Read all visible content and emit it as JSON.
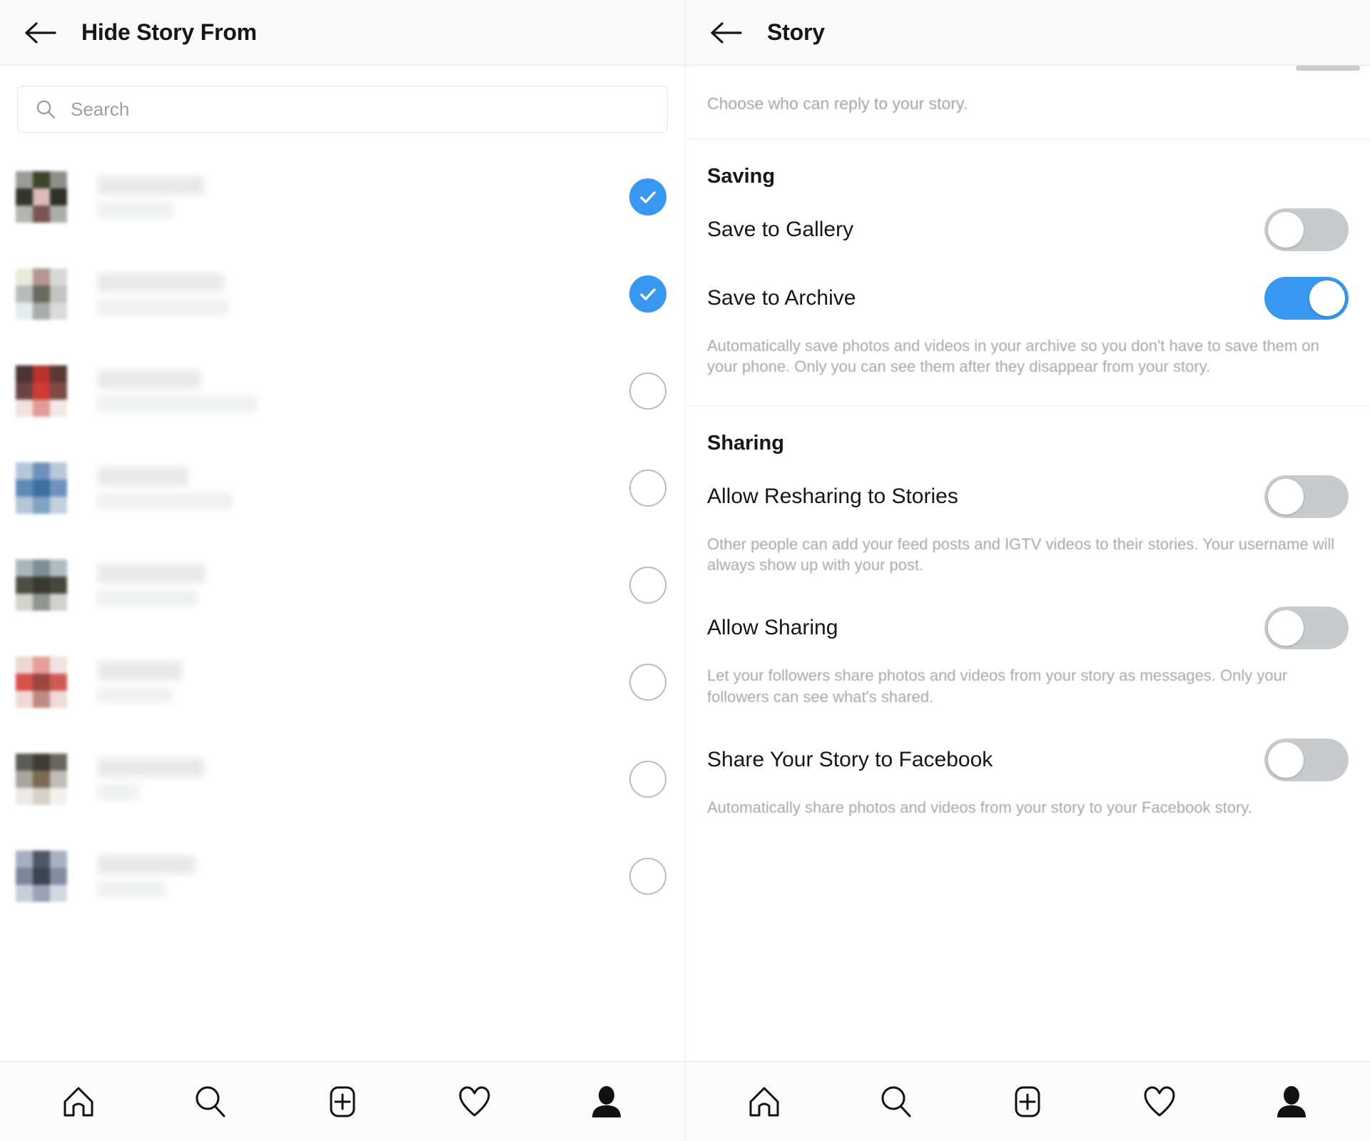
{
  "left_pane": {
    "header": {
      "back_icon": "back-arrow-icon",
      "title": "Hide Story From"
    },
    "search": {
      "icon": "search-icon",
      "placeholder": "Search",
      "value": ""
    },
    "users": [
      {
        "name_width": 150,
        "handle_width": 108,
        "checked": true,
        "avatar": [
          "#9b9b97",
          "#3f4527",
          "#8e8f8c",
          "#33362c",
          "#dcbbb9",
          "#2e3128",
          "#b5b4b0",
          "#7a5452",
          "#aeada9"
        ]
      },
      {
        "name_width": 178,
        "handle_width": 185,
        "checked": true,
        "avatar": [
          "#e9ebd9",
          "#b49792",
          "#d8d9d4",
          "#b8bcbd",
          "#6c6a5e",
          "#c2c4c3",
          "#e4ecef",
          "#a8adaa",
          "#d9dbdc"
        ]
      },
      {
        "name_width": 145,
        "handle_width": 225,
        "checked": false,
        "avatar": [
          "#4a3330",
          "#b9312c",
          "#5b3835",
          "#6c4441",
          "#cf3b35",
          "#7d4a45",
          "#f0e3e0",
          "#e29b96",
          "#f3e8e6"
        ]
      },
      {
        "name_width": 128,
        "handle_width": 190,
        "checked": false,
        "avatar": [
          "#b6c7d9",
          "#6d93bd",
          "#b9c9da",
          "#5f8ab6",
          "#3e6f9e",
          "#6d93bd",
          "#b4c6d8",
          "#7fa2c5",
          "#c2d1e0"
        ]
      },
      {
        "name_width": 152,
        "handle_width": 140,
        "checked": false,
        "avatar": [
          "#a9b7bc",
          "#7d8f96",
          "#b0bcc0",
          "#4f4f41",
          "#3a392c",
          "#47473a",
          "#d4d3cd",
          "#8f9691",
          "#cfd2cf"
        ]
      },
      {
        "name_width": 120,
        "handle_width": 105,
        "checked": false,
        "avatar": [
          "#efd7d4",
          "#e79e99",
          "#f2e2e0",
          "#d6514a",
          "#9a4740",
          "#cf5c54",
          "#efdad5",
          "#c08a80",
          "#eddcd7"
        ]
      },
      {
        "name_width": 150,
        "handle_width": 58,
        "checked": false,
        "avatar": [
          "#5b5b58",
          "#3f3c33",
          "#68675f",
          "#a9a6a0",
          "#7b6b52",
          "#c0bdb6",
          "#eceae6",
          "#d6d2c9",
          "#f2f1ee"
        ]
      },
      {
        "name_width": 138,
        "handle_width": 96,
        "checked": false,
        "avatar": [
          "#a6aec2",
          "#4e5668",
          "#a9b1c4",
          "#7d8699",
          "#3c4352",
          "#858ea1",
          "#c9cedb",
          "#9aa2b3",
          "#d3d8e2"
        ]
      }
    ],
    "tabbar": [
      {
        "icon": "home-icon",
        "label": "Home"
      },
      {
        "icon": "search-icon",
        "label": "Search"
      },
      {
        "icon": "add-post-icon",
        "label": "New Post"
      },
      {
        "icon": "heart-icon",
        "label": "Activity"
      },
      {
        "icon": "profile-icon",
        "label": "Profile"
      }
    ]
  },
  "right_pane": {
    "header": {
      "back_icon": "back-arrow-icon",
      "title": "Story"
    },
    "reply_note": "Choose who can reply to your story.",
    "sections": [
      {
        "title": "Saving",
        "options": [
          {
            "label": "Save to Gallery",
            "state": "off",
            "desc": ""
          },
          {
            "label": "Save to Archive",
            "state": "on",
            "desc": "Automatically save photos and videos in your archive so you don't have to save them on your phone. Only you can see them after they disappear from your story."
          }
        ]
      },
      {
        "title": "Sharing",
        "options": [
          {
            "label": "Allow Resharing to Stories",
            "state": "off",
            "desc": "Other people can add your feed posts and IGTV videos to their stories. Your username will always show up with your post."
          },
          {
            "label": "Allow Sharing",
            "state": "off",
            "desc": "Let your followers share photos and videos from your story as messages. Only your followers can see what's shared."
          },
          {
            "label": "Share Your Story to Facebook",
            "state": "off",
            "desc": "Automatically share photos and videos from your story to your Facebook story."
          }
        ]
      }
    ],
    "tabbar": [
      {
        "icon": "home-icon",
        "label": "Home"
      },
      {
        "icon": "search-icon",
        "label": "Search"
      },
      {
        "icon": "add-post-icon",
        "label": "New Post"
      },
      {
        "icon": "heart-icon",
        "label": "Activity"
      },
      {
        "icon": "profile-icon",
        "label": "Profile"
      }
    ]
  },
  "colors": {
    "accent_blue": "#3897f0",
    "toggle_off": "#c8cbcd",
    "text_primary": "#14171a",
    "text_muted": "#a3a8ac",
    "header_bg": "#fafafa"
  }
}
